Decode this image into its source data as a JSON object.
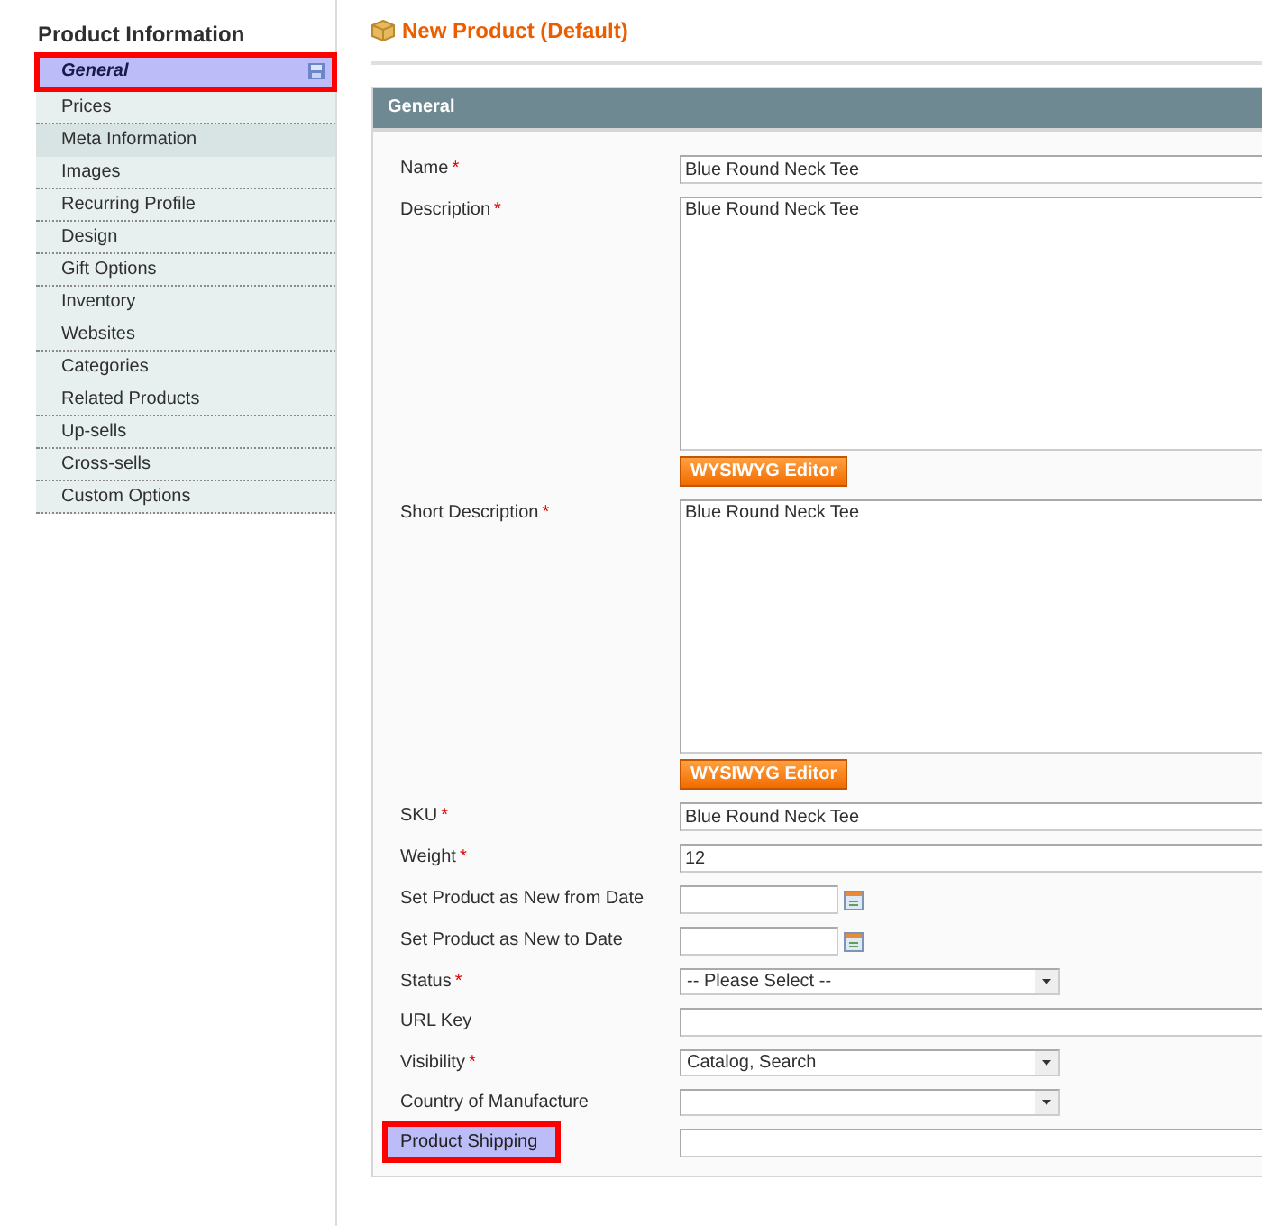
{
  "sidebar": {
    "title": "Product Information",
    "items": [
      {
        "label": "General",
        "selected": true,
        "highlighted": false,
        "rule_below": false,
        "marked": true
      },
      {
        "label": "Prices",
        "selected": false,
        "highlighted": false,
        "rule_below": true,
        "marked": false
      },
      {
        "label": "Meta Information",
        "selected": false,
        "highlighted": true,
        "rule_below": false,
        "marked": false
      },
      {
        "label": "Images",
        "selected": false,
        "highlighted": false,
        "rule_below": true,
        "marked": false
      },
      {
        "label": "Recurring Profile",
        "selected": false,
        "highlighted": false,
        "rule_below": true,
        "marked": false
      },
      {
        "label": "Design",
        "selected": false,
        "highlighted": false,
        "rule_below": true,
        "marked": false
      },
      {
        "label": "Gift Options",
        "selected": false,
        "highlighted": false,
        "rule_below": true,
        "marked": false
      },
      {
        "label": "Inventory",
        "selected": false,
        "highlighted": false,
        "rule_below": false,
        "marked": false
      },
      {
        "label": "Websites",
        "selected": false,
        "highlighted": false,
        "rule_below": true,
        "marked": false
      },
      {
        "label": "Categories",
        "selected": false,
        "highlighted": false,
        "rule_below": false,
        "marked": false
      },
      {
        "label": "Related Products",
        "selected": false,
        "highlighted": false,
        "rule_below": true,
        "marked": false
      },
      {
        "label": "Up-sells",
        "selected": false,
        "highlighted": false,
        "rule_below": true,
        "marked": false
      },
      {
        "label": "Cross-sells",
        "selected": false,
        "highlighted": false,
        "rule_below": true,
        "marked": false
      },
      {
        "label": "Custom Options",
        "selected": false,
        "highlighted": false,
        "rule_below": true,
        "marked": false
      }
    ]
  },
  "page": {
    "title": "New Product (Default)"
  },
  "fieldset": {
    "title": "General",
    "fields": [
      {
        "label": "Name",
        "kind": "text",
        "required": "*",
        "value": "Blue Round Neck Tee",
        "marked": false
      },
      {
        "label": "Description",
        "kind": "textarea",
        "required": "*",
        "value": "Blue Round Neck Tee",
        "button": "WYSIWYG Editor",
        "marked": false
      },
      {
        "label": "Short Description",
        "kind": "textarea",
        "required": "*",
        "value": "Blue Round Neck Tee",
        "button": "WYSIWYG Editor",
        "marked": false
      },
      {
        "label": "SKU",
        "kind": "text",
        "required": "*",
        "value": "Blue Round Neck Tee",
        "marked": false
      },
      {
        "label": "Weight",
        "kind": "text",
        "required": "*",
        "value": "12",
        "marked": false
      },
      {
        "label": "Set Product as New from Date",
        "kind": "date",
        "marked": false
      },
      {
        "label": "Set Product as New to Date",
        "kind": "date",
        "marked": false
      },
      {
        "label": "Status",
        "kind": "select",
        "required": "*",
        "value": "-- Please Select --",
        "marked": false
      },
      {
        "label": "URL Key",
        "kind": "text",
        "marked": false
      },
      {
        "label": "Visibility",
        "kind": "select",
        "required": "*",
        "value": "Catalog, Search",
        "marked": false
      },
      {
        "label": "Country of Manufacture",
        "kind": "select",
        "marked": false
      },
      {
        "label": "Product Shipping",
        "kind": "text",
        "marked": true
      }
    ]
  }
}
